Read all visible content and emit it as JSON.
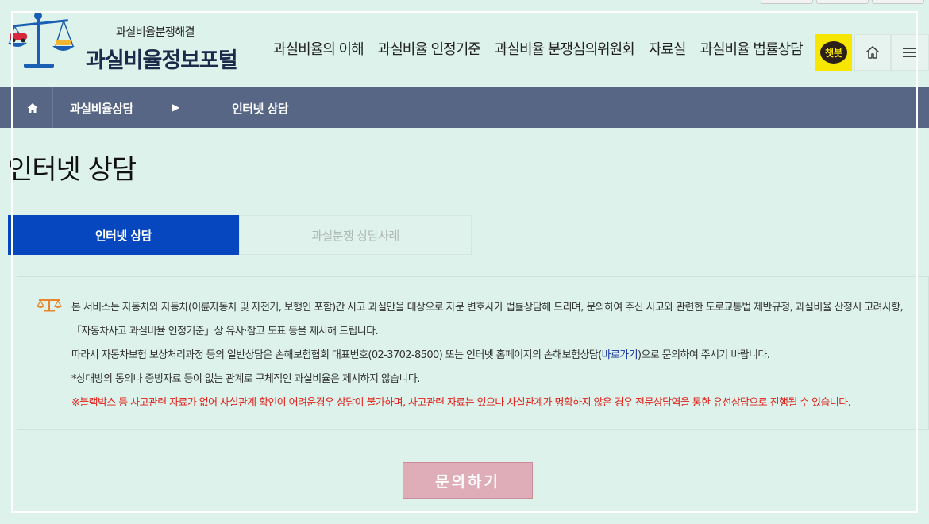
{
  "header": {
    "logo_sub": "과실비율분쟁해결",
    "logo_main": "과실비율정보포털",
    "nav": [
      {
        "label": "과실비율의 이해"
      },
      {
        "label": "과실비율 인정기준"
      },
      {
        "label": "과실비율 분쟁심의위원회"
      },
      {
        "label": "자료실"
      },
      {
        "label": "과실비율 법률상담"
      }
    ],
    "chatbot_label": "챗봇",
    "icons": {
      "home": "home-icon",
      "menu": "hamburger-menu-icon",
      "chatbot": "chatbot-bubble-icon"
    }
  },
  "breadcrumb": {
    "level1": "과실비율상담",
    "level2": "인터넷 상담"
  },
  "page_title": "인터넷 상담",
  "tabs": [
    {
      "label": "인터넷 상담",
      "active": true
    },
    {
      "label": "과실분쟁 상담사례",
      "active": false
    }
  ],
  "notice": {
    "line1": "본 서비스는 자동차와 자동차(이륜자동차 및 자전거, 보행인 포함)간 사고 과실만을 대상으로 자문 변호사가 법률상담해 드리며, 문의하여 주신 사고와 관련한 도로교통법 제반규정, 과실비율 산정시 고려사항,「자동차사고 과실비율 인정기준」상 유사·참고 도표 등을 제시해 드립니다.",
    "line2_before": "따라서 자동차보험 보상처리과정 등의 일반상담은 손해보험협회 대표번호(02-3702-8500) 또는 인터넷 홈페이지의 손해보험상담(",
    "line2_link": "바로가기",
    "line2_after": ")으로 문의하여 주시기 바랍니다.",
    "line3": "*상대방의 동의나 증빙자료 등이 없는 관계로 구체적인 과실비율은 제시하지 않습니다.",
    "line4": "※블랙박스 등 사고관련 자료가 없어 사실관계 확인이 어려운경우 상담이 불가하며, 사고관련 자료는 있으나 사실관계가 명확하지 않은 경우 전문상담역을 통한 유선상담으로 진행될 수 있습니다."
  },
  "submit_label": "문의하기",
  "colors": {
    "background": "#ddf2ea",
    "crumb_bar": "#566684",
    "active_tab": "#0647c0",
    "warning": "#e0211b",
    "submit": "#dfadb8",
    "chatbot": "#f7e600"
  }
}
